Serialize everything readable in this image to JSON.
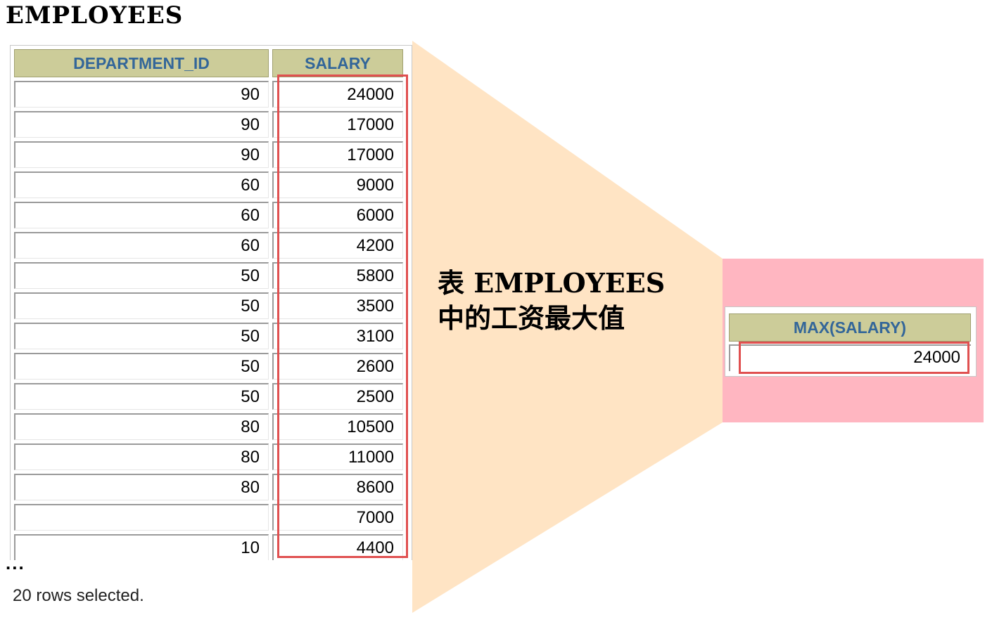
{
  "title": "EMPLOYEES",
  "employees_table": {
    "columns": [
      "DEPARTMENT_ID",
      "SALARY"
    ],
    "rows": [
      {
        "department_id": "90",
        "salary": "24000"
      },
      {
        "department_id": "90",
        "salary": "17000"
      },
      {
        "department_id": "90",
        "salary": "17000"
      },
      {
        "department_id": "60",
        "salary": "9000"
      },
      {
        "department_id": "60",
        "salary": "6000"
      },
      {
        "department_id": "60",
        "salary": "4200"
      },
      {
        "department_id": "50",
        "salary": "5800"
      },
      {
        "department_id": "50",
        "salary": "3500"
      },
      {
        "department_id": "50",
        "salary": "3100"
      },
      {
        "department_id": "50",
        "salary": "2600"
      },
      {
        "department_id": "50",
        "salary": "2500"
      },
      {
        "department_id": "80",
        "salary": "10500"
      },
      {
        "department_id": "80",
        "salary": "11000"
      },
      {
        "department_id": "80",
        "salary": "8600"
      },
      {
        "department_id": "",
        "salary": "7000"
      },
      {
        "department_id": "10",
        "salary": "4400"
      }
    ],
    "ellipsis": "...",
    "rows_selected": "20 rows selected."
  },
  "caption": {
    "line1": "表 EMPLOYEES",
    "line2": "中的工资最大值"
  },
  "result_table": {
    "column": "MAX(SALARY)",
    "value": "24000"
  },
  "colors": {
    "header_bg": "#cccc99",
    "header_text": "#336699",
    "highlight_border": "#e05050",
    "funnel_fill": "#ffe4c4",
    "result_bg": "#ffb6c1"
  }
}
